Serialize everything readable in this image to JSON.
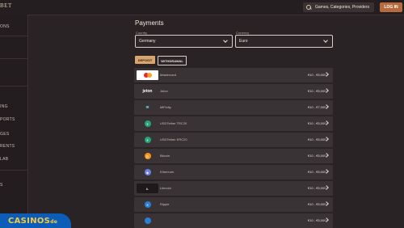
{
  "header": {
    "logo_text": "BET",
    "search_placeholder": "Games, Categories, Providers",
    "login_label": "LOG IN"
  },
  "sidebar": {
    "items": [
      "ONS",
      "ING",
      "PORTS",
      "GES",
      "RENTS",
      "LAB",
      "S"
    ]
  },
  "payments": {
    "title": "Payments",
    "country_label": "Country",
    "country_value": "Germany",
    "currency_label": "Currency",
    "currency_value": "Euro",
    "tabs": [
      "DEPOSIT",
      "WITHDRAWAL"
    ],
    "methods": [
      {
        "name": "Mastercard",
        "limit": "€10 - €5,000",
        "icon": "mastercard-icon"
      },
      {
        "name": "Jeton",
        "limit": "€10 - €5,000",
        "icon": "jeton-icon"
      },
      {
        "name": "MiFinity",
        "limit": "€10 - €7,000",
        "icon": "mifinity-icon"
      },
      {
        "name": "USDTether TRC20",
        "limit": "€10 - €5,000",
        "icon": "tether-trc20-icon"
      },
      {
        "name": "USDTether ERC20",
        "limit": "€10 - €5,000",
        "icon": "tether-erc20-icon"
      },
      {
        "name": "Bitcoin",
        "limit": "€10 - €5,000",
        "icon": "bitcoin-icon"
      },
      {
        "name": "Ethereum",
        "limit": "€10 - €5,000",
        "icon": "ethereum-icon"
      },
      {
        "name": "Litecoin",
        "limit": "€10 - €5,000",
        "icon": "litecoin-icon"
      },
      {
        "name": "Ripple",
        "limit": "€10 - €5,000",
        "icon": "ripple-icon"
      },
      {
        "name": "",
        "limit": "€10 - €5,000",
        "icon": "crypto-icon"
      }
    ]
  },
  "watermark": {
    "text": "CASINOS",
    "suffix": "de"
  },
  "colors": {
    "background": "#2a2326",
    "accent": "#b56b3e",
    "tab_active": "#d9a56d",
    "row": "#3a3336"
  }
}
